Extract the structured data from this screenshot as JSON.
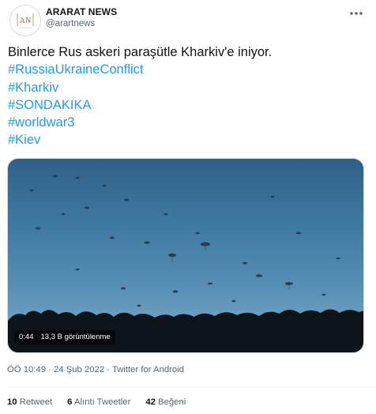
{
  "author": {
    "display_name": "ARARAT NEWS",
    "handle": "@arartnews",
    "avatar_text": "AN"
  },
  "tweet": {
    "lines": [
      {
        "text": "Binlerce Rus askeri paraşütle Kharkiv'e iniyor.",
        "type": "text"
      },
      {
        "text": "#RussiaUkraineConflict",
        "type": "hashtag"
      },
      {
        "text": "#Kharkiv",
        "type": "hashtag"
      },
      {
        "text": "#SONDAKIKA",
        "type": "hashtag"
      },
      {
        "text": "#worldwar3",
        "type": "hashtag"
      },
      {
        "text": "#Kiev",
        "type": "hashtag"
      }
    ]
  },
  "media": {
    "duration": "0:44",
    "views": "13,3 B görüntülenme"
  },
  "meta": {
    "time": "ÖÖ 10:49",
    "separator": "·",
    "date": "24 Şub 2022",
    "source": "Twitter for Android"
  },
  "stats": {
    "retweets_count": "10",
    "retweets_label": "Retweet",
    "quotes_count": "6",
    "quotes_label": "Alıntı Tweetler",
    "likes_count": "42",
    "likes_label": "Beğeni"
  },
  "colors": {
    "link": "#1d9bf0",
    "secondary_text": "#536471",
    "primary_text": "#0f1419"
  },
  "icons": {
    "more": "more-horizontal-icon"
  }
}
